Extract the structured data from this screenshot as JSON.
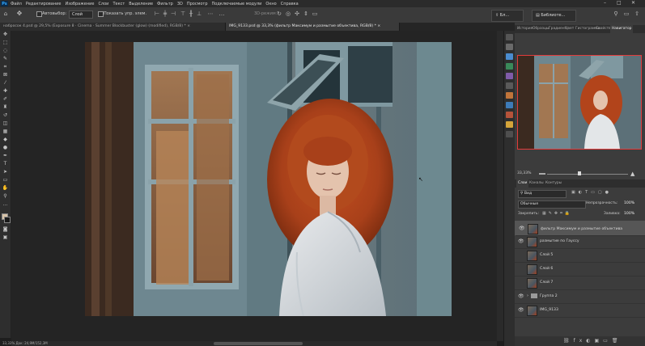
{
  "app": {
    "logo": "Ps"
  },
  "menu": [
    "Файл",
    "Редактирование",
    "Изображение",
    "Слои",
    "Текст",
    "Выделение",
    "Фильтр",
    "3D",
    "Просмотр",
    "Подключаемые модули",
    "Окно",
    "Справка"
  ],
  "options": {
    "autoselect_label": "Автовыбор:",
    "autoselect_value": "Слой",
    "show_controls_label": "Показать упр. элем.",
    "mode_3d_label": "3D-режим:"
  },
  "top_buttons": {
    "share": "Бл...",
    "libraries": "Библиоте..."
  },
  "tabs": [
    {
      "label": "набросок 4.psd @ 29,5% (Exposure 8 · Cinema · Summer Blockbuster (glow) (modified), RGB/8) *",
      "active": false
    },
    {
      "label": "IMG_9133.psd @ 33,3% (фильтр Максимум и размытие объектива, RGB/8) *",
      "active": true
    }
  ],
  "panel_tabs_top": [
    "История",
    "Образцы",
    "Градиент",
    "Цвет",
    "Гистограмма",
    "Свойства",
    "Навигатор"
  ],
  "navigator": {
    "zoom": "33,33%"
  },
  "panel_tabs_layers": [
    "Слои",
    "Каналы",
    "Контуры"
  ],
  "layers_panel": {
    "filter_kind": "Вид",
    "blend_mode": "Обычные",
    "opacity_label": "Непрозрачность:",
    "opacity_value": "100%",
    "lock_label": "Закрепить:",
    "fill_label": "Заливка:",
    "fill_value": "100%"
  },
  "layers": [
    {
      "name": "фильтр Максимум и размытие объектива",
      "visible": true,
      "selected": true
    },
    {
      "name": "размытие по Гауссу",
      "visible": true,
      "selected": false
    },
    {
      "name": "Слой 5",
      "visible": false,
      "selected": false
    },
    {
      "name": "Слой 6",
      "visible": false,
      "selected": false
    },
    {
      "name": "Слой 7",
      "visible": false,
      "selected": false
    },
    {
      "name": "Группа 2",
      "visible": true,
      "selected": false
    },
    {
      "name": "IMG_9133",
      "visible": true,
      "selected": false
    }
  ],
  "status": {
    "text": "33,33%  Док: 24,9M/152,3M"
  }
}
